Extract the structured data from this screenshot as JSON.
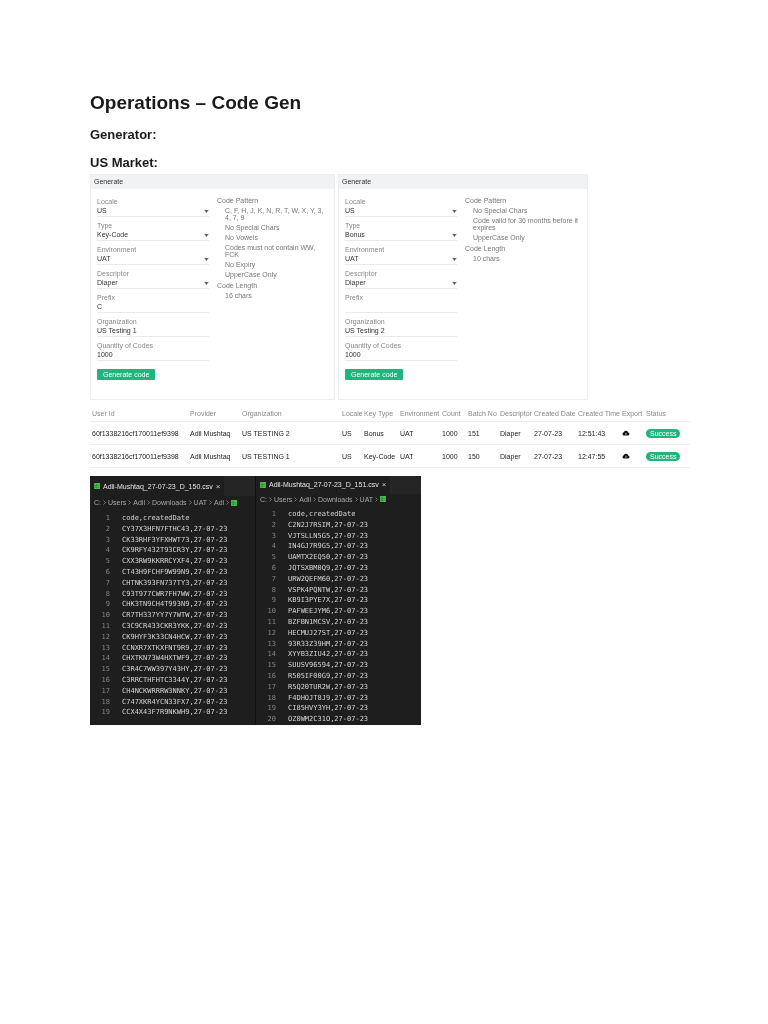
{
  "title": "Operations – Code Gen",
  "headings": [
    "Generator:",
    "US Market:"
  ],
  "forms": [
    {
      "header": "Generate",
      "fields": [
        {
          "label": "Locale",
          "value": "US",
          "kind": "select"
        },
        {
          "label": "Type",
          "value": "Key-Code",
          "kind": "select"
        },
        {
          "label": "Environment",
          "value": "UAT",
          "kind": "select"
        },
        {
          "label": "Descriptor",
          "value": "Diaper",
          "kind": "select"
        },
        {
          "label": "Prefix",
          "value": "C",
          "kind": "text"
        },
        {
          "label": "Organization",
          "value": "US Testing 1",
          "kind": "text"
        },
        {
          "label": "Quantity of Codes",
          "value": "1000",
          "kind": "text"
        }
      ],
      "rules": [
        {
          "label": "Code Pattern",
          "items": [
            "C, F, H, J, K, N, R, T, W, X, Y, 3, 4, 7, 9",
            "No Special Chars",
            "No Vowels",
            "Codes must not contain WW, FCK",
            "No Expiry",
            "UpperCase Only"
          ]
        },
        {
          "label": "Code Length",
          "items": [
            "16 chars"
          ]
        }
      ],
      "button": "Generate code"
    },
    {
      "header": "Generate",
      "fields": [
        {
          "label": "Locale",
          "value": "US",
          "kind": "select"
        },
        {
          "label": "Type",
          "value": "Bonus",
          "kind": "select"
        },
        {
          "label": "Environment",
          "value": "UAT",
          "kind": "select"
        },
        {
          "label": "Descriptor",
          "value": "Diaper",
          "kind": "select"
        },
        {
          "label": "Prefix",
          "kind": "text"
        },
        {
          "label": "Organization",
          "value": "US Testing 2",
          "kind": "text"
        },
        {
          "label": "Quantity of Codes",
          "value": "1000",
          "kind": "text"
        }
      ],
      "rules": [
        {
          "label": "Code Pattern",
          "items": [
            "No Special Chars",
            "Code valid for 36 months before it expires",
            "UpperCase Only"
          ]
        },
        {
          "label": "Code Length",
          "items": [
            "10 chars"
          ]
        }
      ],
      "button": "Generate code"
    }
  ],
  "table": {
    "columns": [
      "User Id",
      "Provider",
      "Organization",
      "Locale",
      "Key Type",
      "Environment",
      "Count",
      "Batch No",
      "Descriptor",
      "Created Date",
      "Created Time",
      "Export",
      "Status"
    ],
    "rows": [
      {
        "cells": [
          "60f1338216cf170011ef9398",
          "Adil Mushtaq",
          "US TESTING 2",
          "US",
          "Bonus",
          "UAT",
          "1000",
          "151",
          "Diaper",
          "27-07-23",
          "12:51:43"
        ],
        "status": "Success"
      },
      {
        "cells": [
          "60f1338216cf170011ef9398",
          "Adil Mushtaq",
          "US TESTING 1",
          "US",
          "Key-Code",
          "UAT",
          "1000",
          "150",
          "Diaper",
          "27-07-23",
          "12:47:55"
        ],
        "status": "Success"
      }
    ]
  },
  "editors": [
    {
      "tab": "Adil-Mushtaq_27-07-23_D_150.csv",
      "close": "×",
      "breadcrumb": [
        "C:",
        "Users",
        "Adil",
        "Downloads",
        "UAT",
        "Adi"
      ],
      "lines": [
        {
          "number": "1",
          "text": "code,createdDate"
        },
        {
          "number": "2",
          "text": "CY37X3HFN7FTHC43,27-07-23"
        },
        {
          "number": "3",
          "text": "CK33RHF3YFXHWT73,27-07-23"
        },
        {
          "number": "4",
          "text": "CK9RFY432T93CR3Y,27-07-23"
        },
        {
          "number": "5",
          "text": "CXX3RW9KKRRCYXF4,27-07-23"
        },
        {
          "number": "6",
          "text": "CT43H9FCHF9W99N9,27-07-23"
        },
        {
          "number": "7",
          "text": "CHTNK393FN737TY3,27-07-23"
        },
        {
          "number": "8",
          "text": "C93T977CWR7FH7WW,27-07-23"
        },
        {
          "number": "9",
          "text": "CHK3TN9CH4T993N9,27-07-23"
        },
        {
          "number": "10",
          "text": "CR7TH337YY7Y7WTW,27-07-23"
        },
        {
          "number": "11",
          "text": "C3C9CR433CKR3YKK,27-07-23"
        },
        {
          "number": "12",
          "text": "CK9HYF3K33CN4HCW,27-07-23"
        },
        {
          "number": "13",
          "text": "CCNXR7XTKXFNT9R9,27-07-23"
        },
        {
          "number": "14",
          "text": "CHXTKN73W4HXTWF9,27-07-23"
        },
        {
          "number": "15",
          "text": "C3R4C7WW397Y43HY,27-07-23"
        },
        {
          "number": "16",
          "text": "C3RRCTHFHTC3344Y,27-07-23"
        },
        {
          "number": "17",
          "text": "CH4NCKWRRRW3NNKY,27-07-23"
        },
        {
          "number": "18",
          "text": "C747XKR4YCN33FX7,27-07-23"
        },
        {
          "number": "19",
          "text": "CCX4X43F7R9NKWH9,27-07-23"
        }
      ]
    },
    {
      "tab": "Adil-Mushtaq_27-07-23_D_151.csv",
      "close": "×",
      "breadcrumb": [
        "C:",
        "Users",
        "Adil",
        "Downloads",
        "UAT"
      ],
      "lines": [
        {
          "number": "1",
          "text": "code,createdDate"
        },
        {
          "number": "2",
          "text": "C2N2J7RSIM,27-07-23"
        },
        {
          "number": "3",
          "text": "VJTSLLN5G5,27-07-23"
        },
        {
          "number": "4",
          "text": "IN4GJ7R9G5,27-07-23"
        },
        {
          "number": "5",
          "text": "UAMTX2EQ50,27-07-23"
        },
        {
          "number": "6",
          "text": "JQTSXBM0Q9,27-07-23"
        },
        {
          "number": "7",
          "text": "URW2QEFM60,27-07-23"
        },
        {
          "number": "8",
          "text": "VSPK4PQNTW,27-07-23"
        },
        {
          "number": "9",
          "text": "KB9I3PYE7X,27-07-23"
        },
        {
          "number": "10",
          "text": "PAFWEEJYM6,27-07-23"
        },
        {
          "number": "11",
          "text": "BZFBN1MCSV,27-07-23"
        },
        {
          "number": "12",
          "text": "HECMUJ27ST,27-07-23"
        },
        {
          "number": "13",
          "text": "93R33Z39HM,27-07-23"
        },
        {
          "number": "14",
          "text": "XYYB3ZIU42,27-07-23"
        },
        {
          "number": "15",
          "text": "SUUSV96594,27-07-23"
        },
        {
          "number": "16",
          "text": "R505IF00G9,27-07-23"
        },
        {
          "number": "17",
          "text": "R5Q20TUR2W,27-07-23"
        },
        {
          "number": "18",
          "text": "F4DHOJT8J9,27-07-23"
        },
        {
          "number": "19",
          "text": "CI85HVY3YH,27-07-23"
        },
        {
          "number": "20",
          "text": "OZ0WM2C31O,27-07-23"
        }
      ]
    }
  ]
}
